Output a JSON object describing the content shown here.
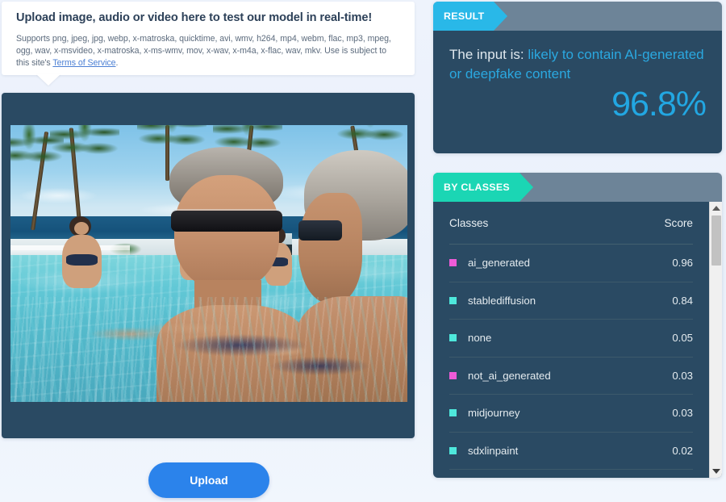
{
  "colors": {
    "page_bg": "#eef3fb",
    "panel_dark": "#2a4a63",
    "panel_header_gray": "#6d8498",
    "result_accent": "#29b8e8",
    "classes_accent": "#1bd6b4",
    "upload_blue": "#2b83eb",
    "link_blue": "#4b7fd4",
    "swatch_magenta": "#ef5bd8",
    "swatch_cyan": "#4ee8dc"
  },
  "info_card": {
    "title": "Upload image, audio or video here to test our model in real-time!",
    "description_before_link": "Supports png, jpeg, jpg, webp, x-matroska, quicktime, avi, wmv, h264, mp4, webm, flac, mp3, mpeg, ogg, wav, x-msvideo, x-matroska, x-ms-wmv, mov, x-wav, x-m4a, x-flac, wav, mkv. Use is subject to this site's ",
    "link_label": "Terms of Service",
    "description_after_link": "."
  },
  "preview": {
    "alt": "pool-photo-two-men-in-swimming-pool"
  },
  "upload": {
    "label": "Upload"
  },
  "result": {
    "tab_label": "RESULT",
    "prefix": "The input is: ",
    "verdict": "likely to contain AI-generated or deepfake content",
    "score": "96.8%"
  },
  "classes": {
    "tab_label": "BY CLASSES",
    "header": {
      "name": "Classes",
      "score": "Score"
    },
    "rows": [
      {
        "name": "ai_generated",
        "score": "0.96",
        "color": "#ef5bd8"
      },
      {
        "name": "stablediffusion",
        "score": "0.84",
        "color": "#4ee8dc"
      },
      {
        "name": "none",
        "score": "0.05",
        "color": "#4ee8dc"
      },
      {
        "name": "not_ai_generated",
        "score": "0.03",
        "color": "#ef5bd8"
      },
      {
        "name": "midjourney",
        "score": "0.03",
        "color": "#4ee8dc"
      },
      {
        "name": "sdxlinpaint",
        "score": "0.02",
        "color": "#4ee8dc"
      }
    ],
    "scrollbar": {
      "up_icon": "chevron-up-icon",
      "down_icon": "chevron-down-icon"
    }
  },
  "chart_data": {
    "type": "bar",
    "title": "By classes detection scores",
    "categories": [
      "ai_generated",
      "stablediffusion",
      "none",
      "not_ai_generated",
      "midjourney",
      "sdxlinpaint"
    ],
    "values": [
      0.96,
      0.84,
      0.05,
      0.03,
      0.03,
      0.02
    ],
    "xlabel": "Classes",
    "ylabel": "Score",
    "ylim": [
      0,
      1
    ]
  }
}
